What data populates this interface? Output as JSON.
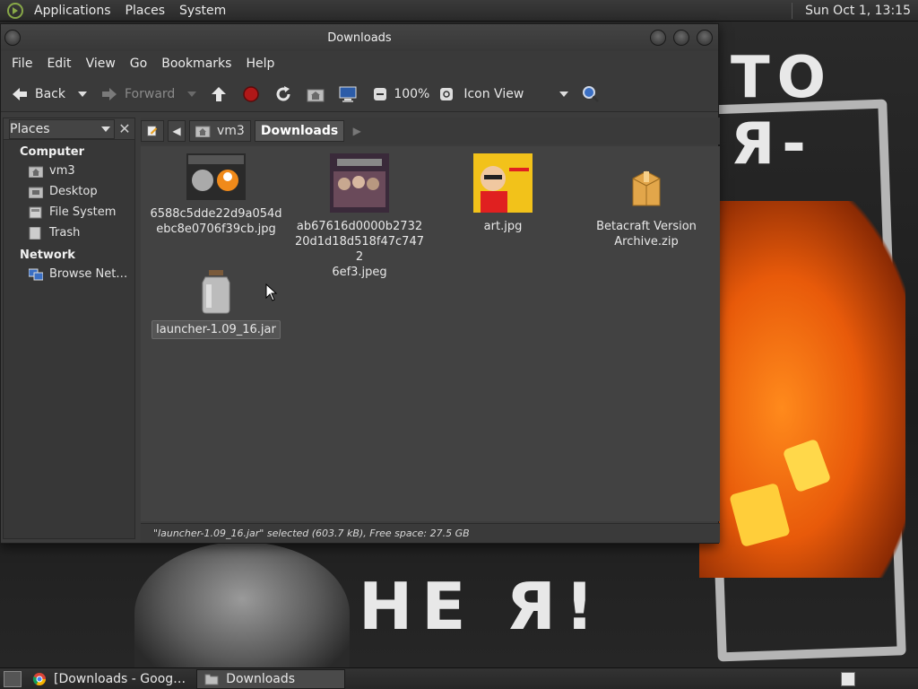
{
  "top_panel": {
    "menus": [
      "Applications",
      "Places",
      "System"
    ],
    "clock": "Sun Oct  1, 13:15"
  },
  "wallpaper": {
    "text_top": "ТО Я-",
    "text_bottom": "НЕ Я!"
  },
  "window": {
    "title": "Downloads",
    "menubar": [
      "File",
      "Edit",
      "View",
      "Go",
      "Bookmarks",
      "Help"
    ],
    "toolbar": {
      "back_label": "Back",
      "forward_label": "Forward",
      "zoom": "100%",
      "view_mode": "Icon View"
    },
    "sidebar": {
      "selector": "Places",
      "sections": [
        {
          "title": "Computer",
          "items": [
            {
              "label": "vm3",
              "icon": "home-folder-icon"
            },
            {
              "label": "Desktop",
              "icon": "desktop-folder-icon"
            },
            {
              "label": "File System",
              "icon": "drive-icon"
            },
            {
              "label": "Trash",
              "icon": "trash-icon"
            }
          ]
        },
        {
          "title": "Network",
          "items": [
            {
              "label": "Browse Net…",
              "icon": "network-icon"
            }
          ]
        }
      ]
    },
    "pathbar": {
      "segments": [
        "vm3",
        "Downloads"
      ],
      "active": "Downloads"
    },
    "files": [
      {
        "name": "6588c5dde22d9a054d\nebc8e0706f39cb.jpg",
        "type": "image-thumb-comic",
        "selected": false
      },
      {
        "name": "ab67616d0000b2732\n20d1d18d518f47c7472\n6ef3.jpeg",
        "type": "image-thumb-band",
        "selected": false
      },
      {
        "name": "art.jpg",
        "type": "image-thumb-art",
        "selected": false
      },
      {
        "name": "Betacraft Version\nArchive.zip",
        "type": "archive-icon",
        "selected": false
      },
      {
        "name": "launcher-1.09_16.jar",
        "type": "jar-icon",
        "selected": true
      }
    ],
    "status": "\"launcher-1.09_16.jar\" selected (603.7 kB), Free space: 27.5 GB"
  },
  "taskbar": {
    "tasks": [
      {
        "label": "[Downloads - Goog…",
        "icon": "chrome-icon",
        "active": false
      },
      {
        "label": "Downloads",
        "icon": "folder-icon",
        "active": true
      }
    ]
  },
  "colors": {
    "panel": "#2b2b2b",
    "window_bg": "#3c3c3c",
    "iconview_bg": "#424242",
    "accent_orange": "#e85a0a"
  }
}
